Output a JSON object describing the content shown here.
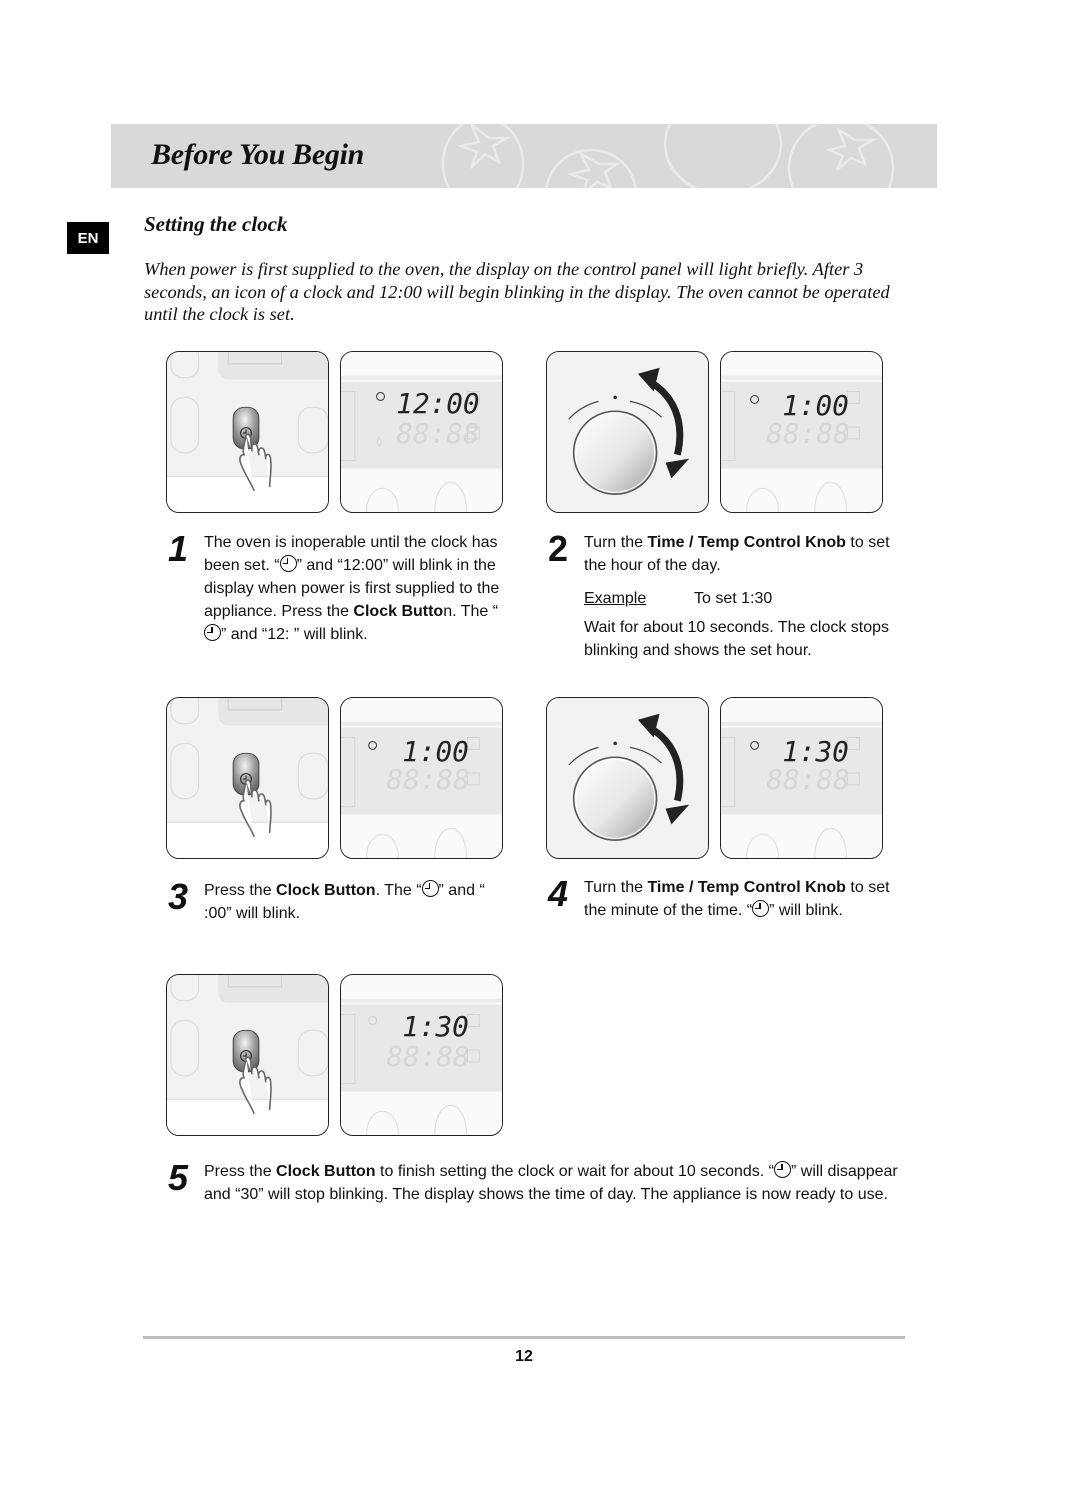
{
  "header": {
    "title": "Before You Begin"
  },
  "language_badge": "EN",
  "section": {
    "title": "Setting the clock",
    "intro": "When power is first supplied to the oven, the display on the control panel will light briefly. After 3 seconds, an icon of a clock and 12:00 will begin blinking in the display. The oven cannot be operated until the clock is set."
  },
  "illustrations": {
    "step1": {
      "display_time": "12:00"
    },
    "step2": {
      "display_time": "1:00"
    },
    "step3": {
      "display_time": "1:00"
    },
    "step4": {
      "display_time": "1:30"
    },
    "step5": {
      "display_time": "1:30"
    },
    "inactive_digits": "88:88"
  },
  "steps": [
    {
      "number": "1",
      "parts": {
        "a": "The oven is inoperable until the clock has been set. “",
        "b": "” and “12:00” will blink in the display when power is first supplied to the appliance. Press the ",
        "bold1": "Clock Butto",
        "c": "n. The “",
        "d": "” and “12: ” will blink."
      }
    },
    {
      "number": "2",
      "parts": {
        "a": "Turn the ",
        "bold1": "Time / Temp Control Knob",
        "b": " to set the hour of the day."
      },
      "example_label": "Example",
      "example_value": "To set 1:30",
      "note": "Wait for about 10 seconds. The clock stops blinking and shows the set hour."
    },
    {
      "number": "3",
      "parts": {
        "a": "Press the ",
        "bold1": "Clock Button",
        "b": ". The “",
        "c": "” and “ :00” will blink."
      }
    },
    {
      "number": "4",
      "parts": {
        "a": "Turn the ",
        "bold1": "Time / Temp Control Knob",
        "b": " to set the minute of the time. “",
        "c": "” will blink."
      }
    },
    {
      "number": "5",
      "parts": {
        "a": "Press the ",
        "bold1": "Clock Button",
        "b": " to finish setting the clock or wait for about 10 seconds. “",
        "c": "” will disappear and “30” will stop blinking. The display shows the time of day. The appliance is now ready to use."
      }
    }
  ],
  "footer": {
    "page_number": "12"
  }
}
